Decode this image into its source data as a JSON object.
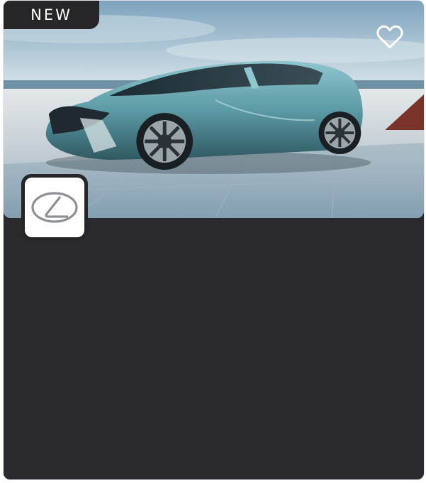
{
  "card": {
    "badge_label": "NEW",
    "favorite_icon": "heart-outline-icon",
    "brand_logo_icon": "lexus-logo-icon",
    "hero_image": "concept-car-photo",
    "colors": {
      "card_background": "#2a2a2e",
      "badge_background": "#262628",
      "badge_text": "#ffffff",
      "favorite_icon": "#ffffff",
      "logo_tile": "#ffffff"
    }
  }
}
